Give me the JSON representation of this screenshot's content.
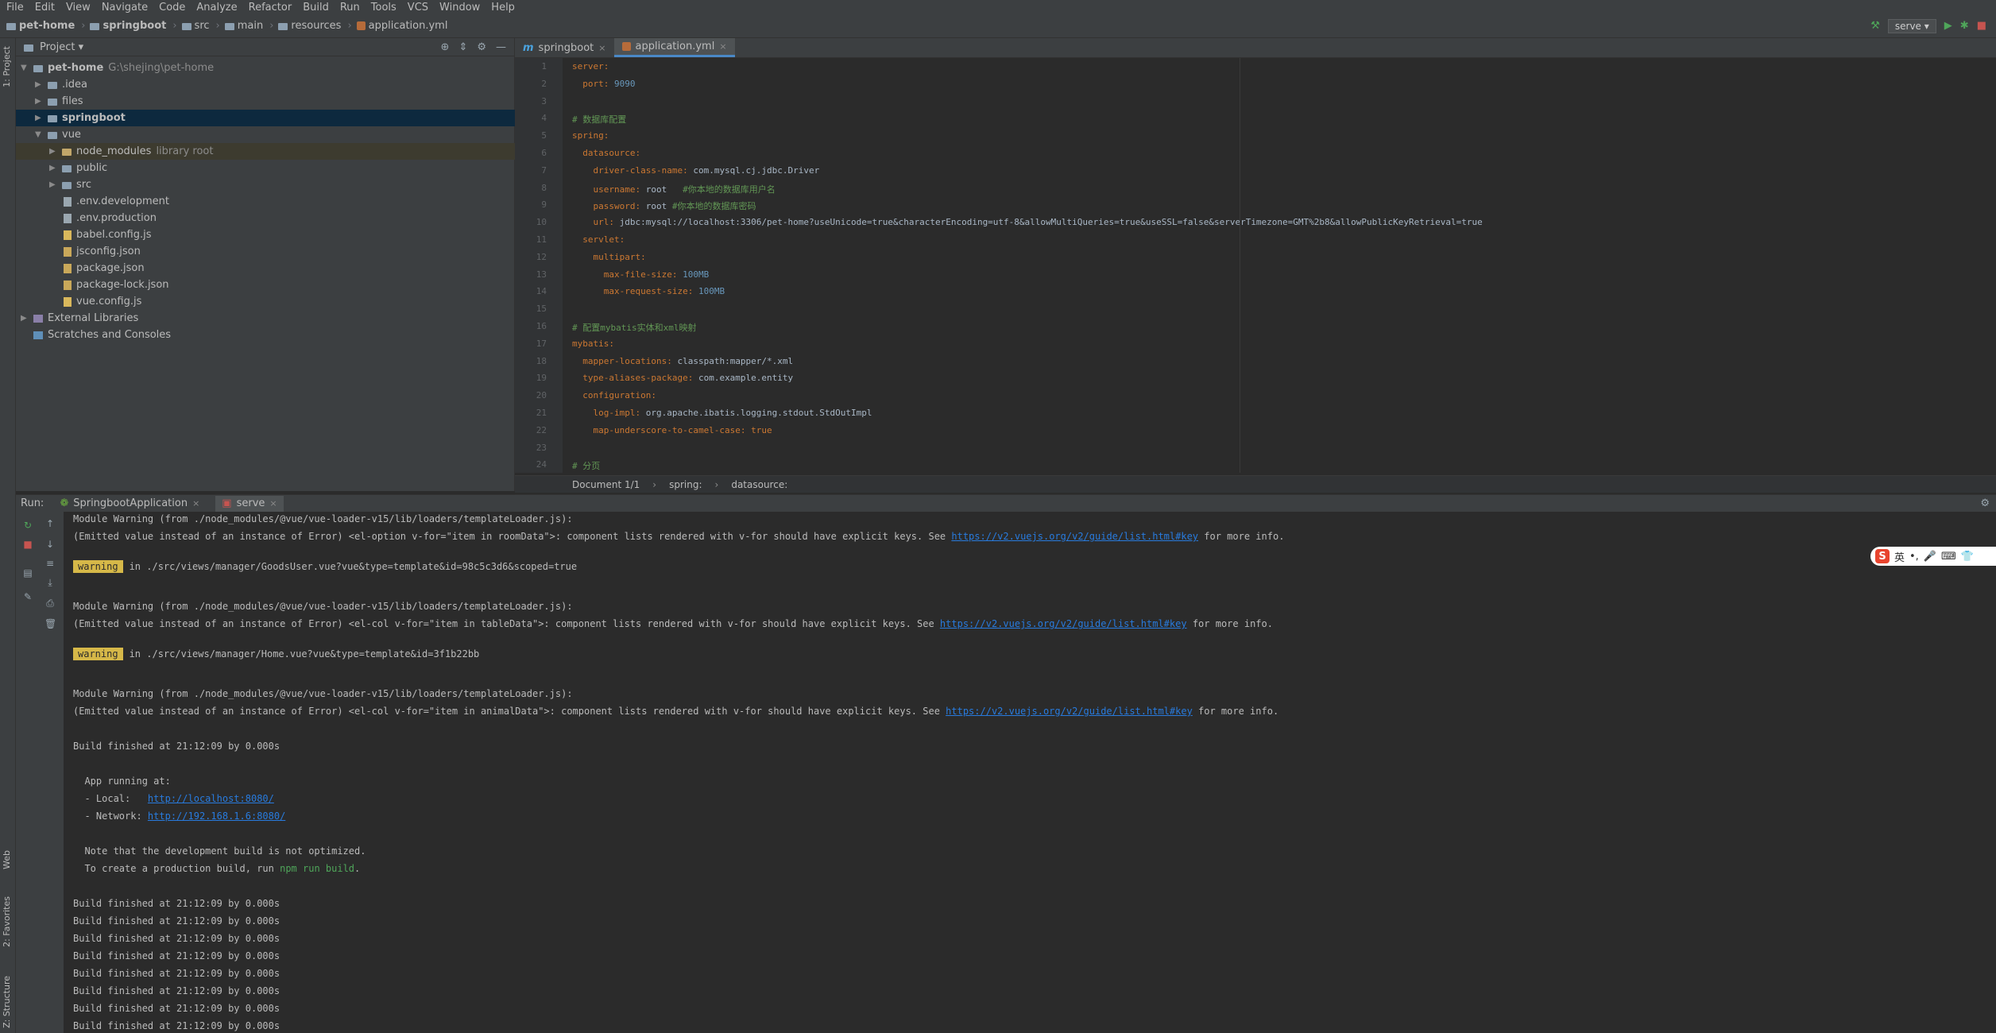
{
  "menu": [
    "File",
    "Edit",
    "View",
    "Navigate",
    "Code",
    "Analyze",
    "Refactor",
    "Build",
    "Run",
    "Tools",
    "VCS",
    "Window",
    "Help"
  ],
  "breadcrumb": [
    "pet-home",
    "springboot",
    "src",
    "main",
    "resources",
    "application.yml"
  ],
  "run_config": "serve",
  "left_stripe": {
    "project": "1: Project",
    "web": "Web",
    "favorites": "2: Favorites",
    "structure": "Z: Structure"
  },
  "project_panel": {
    "title": "Project",
    "tree": [
      {
        "label": "pet-home",
        "extra": "G:\\shejing\\pet-home",
        "bold": true
      },
      {
        "label": ".idea"
      },
      {
        "label": "files"
      },
      {
        "label": "springboot",
        "bold": true
      },
      {
        "label": "vue"
      },
      {
        "label": "node_modules",
        "extra": "library root"
      },
      {
        "label": "public"
      },
      {
        "label": "src"
      },
      {
        "label": ".env.development"
      },
      {
        "label": ".env.production"
      },
      {
        "label": "babel.config.js"
      },
      {
        "label": "jsconfig.json"
      },
      {
        "label": "package.json"
      },
      {
        "label": "package-lock.json"
      },
      {
        "label": "vue.config.js"
      },
      {
        "label": "External Libraries"
      },
      {
        "label": "Scratches and Consoles"
      }
    ]
  },
  "editor": {
    "tabs": [
      "springboot",
      "application.yml"
    ],
    "lines": [
      {
        "n": "1",
        "k": "server:",
        "v": ""
      },
      {
        "n": "2",
        "k": "  port:",
        "v": " 9090"
      },
      {
        "n": "3",
        "k": "",
        "v": ""
      },
      {
        "n": "4",
        "k": "",
        "v": "# 数据库配置"
      },
      {
        "n": "5",
        "k": "spring:",
        "v": ""
      },
      {
        "n": "6",
        "k": "  datasource:",
        "v": ""
      },
      {
        "n": "7",
        "k": "    driver-class-name:",
        "v": " com.mysql.cj.jdbc.Driver"
      },
      {
        "n": "8",
        "k": "    username:",
        "v": " root   #你本地的数据库用户名"
      },
      {
        "n": "9",
        "k": "    password:",
        "v": " root #你本地的数据库密码"
      },
      {
        "n": "10",
        "k": "    url:",
        "v": " jdbc:mysql://localhost:3306/pet-home?useUnicode=true&characterEncoding=utf-8&allowMultiQueries=true&useSSL=false&serverTimezone=GMT%2b8&allowPublicKeyRetrieval=true"
      },
      {
        "n": "11",
        "k": "  servlet:",
        "v": ""
      },
      {
        "n": "12",
        "k": "    multipart:",
        "v": ""
      },
      {
        "n": "13",
        "k": "      max-file-size:",
        "v": " 100MB"
      },
      {
        "n": "14",
        "k": "      max-request-size:",
        "v": " 100MB"
      },
      {
        "n": "15",
        "k": "",
        "v": ""
      },
      {
        "n": "16",
        "k": "",
        "v": "# 配置mybatis实体和xml映射"
      },
      {
        "n": "17",
        "k": "mybatis:",
        "v": ""
      },
      {
        "n": "18",
        "k": "  mapper-locations:",
        "v": " classpath:mapper/*.xml"
      },
      {
        "n": "19",
        "k": "  type-aliases-package:",
        "v": " com.example.entity"
      },
      {
        "n": "20",
        "k": "  configuration:",
        "v": ""
      },
      {
        "n": "21",
        "k": "    log-impl:",
        "v": " org.apache.ibatis.logging.stdout.StdOutImpl"
      },
      {
        "n": "22",
        "k": "    map-underscore-to-camel-case:",
        "v": " true"
      },
      {
        "n": "23",
        "k": "",
        "v": ""
      },
      {
        "n": "24",
        "k": "",
        "v": "# 分页"
      }
    ],
    "status": [
      "Document 1/1",
      "spring:",
      "datasource:"
    ]
  },
  "run_panel": {
    "label": "Run:",
    "tabs": [
      "SpringbootApplication",
      "serve"
    ]
  },
  "console": {
    "l1": "Module Warning (from ./node_modules/@vue/vue-loader-v15/lib/loaders/templateLoader.js):",
    "l2a": "(Emitted value instead of an instance of Error) <el-option v-for=\"item in roomData\">: component lists rendered with v-for should have explicit keys. See ",
    "link1": "https://v2.vuejs.org/v2/guide/list.html#key",
    "more": " for more info.",
    "warn": "warning",
    "w1": "in ./src/views/manager/GoodsUser.vue?vue&type=template&id=98c5c3d6&scoped=true",
    "l3": "Module Warning (from ./node_modules/@vue/vue-loader-v15/lib/loaders/templateLoader.js):",
    "l4a": "(Emitted value instead of an instance of Error) <el-col v-for=\"item in tableData\">: component lists rendered with v-for should have explicit keys. See ",
    "w2": "in ./src/views/manager/Home.vue?vue&type=template&id=3f1b22bb",
    "l5": "Module Warning (from ./node_modules/@vue/vue-loader-v15/lib/loaders/templateLoader.js):",
    "l6a": "(Emitted value instead of an instance of Error) <el-col v-for=\"item in animalData\">: component lists rendered with v-for should have explicit keys. See ",
    "build": "Build finished at 21:12:09 by 0.000s",
    "app_running": "  App running at:",
    "local_label": "  - Local:   ",
    "local_url": "http://localhost:8080/",
    "network_label": "  - Network: ",
    "network_url": "http://192.168.1.6:8080/",
    "note1": "  Note that the development build is not optimized.",
    "note2a": "  To create a production build, run ",
    "note2b": "npm run build",
    "note2c": "."
  },
  "ime": {
    "label": "英"
  }
}
